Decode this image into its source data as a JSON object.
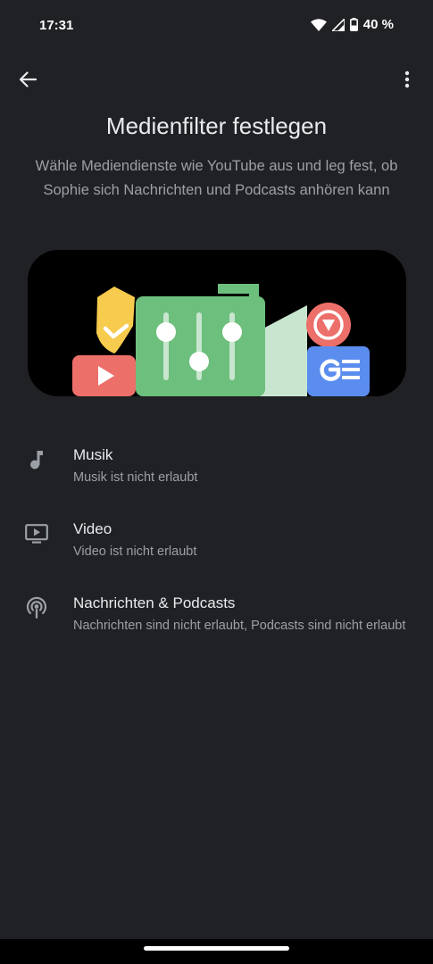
{
  "status_bar": {
    "time": "17:31",
    "battery": "40 %",
    "icons": [
      "wifi-icon",
      "signal-icon",
      "battery-icon"
    ]
  },
  "app_bar": {
    "back_icon": "arrow-back-icon",
    "menu_icon": "more-vert-icon"
  },
  "page": {
    "title": "Medienfilter festlegen",
    "description": "Wähle Mediendienste wie YouTube aus und leg fest, ob Sophie sich Nachrichten und Podcasts anhören kann"
  },
  "hero": {
    "icons": [
      "youtube-icon",
      "badge-check-icon",
      "equalizer-icon",
      "play-circle-icon",
      "google-news-icon"
    ],
    "colors": {
      "background": "#000000",
      "green": "#6dbf7d",
      "light_green": "#c8e6cf",
      "red": "#ec6f6a",
      "yellow": "#f7cb4d",
      "blue": "#5b8def"
    }
  },
  "filters": [
    {
      "icon": "music-note-icon",
      "title": "Musik",
      "subtitle": "Musik ist nicht erlaubt"
    },
    {
      "icon": "tv-play-icon",
      "title": "Video",
      "subtitle": "Video ist nicht erlaubt"
    },
    {
      "icon": "podcast-icon",
      "title": "Nachrichten & Podcasts",
      "subtitle": "Nachrichten sind nicht erlaubt, Podcasts sind nicht erlaubt"
    }
  ],
  "colors": {
    "background": "#202124",
    "text_primary": "#e8eaed",
    "text_secondary": "#9aa0a6"
  }
}
